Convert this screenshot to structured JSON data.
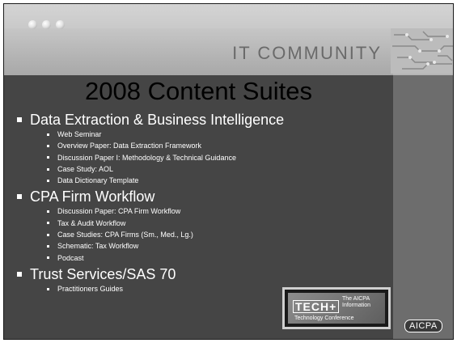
{
  "header": {
    "title": "IT COMMUNITY"
  },
  "slide": {
    "title": "2008 Content Suites"
  },
  "sections": [
    {
      "title": "Data Extraction & Business Intelligence",
      "items": [
        "Web Seminar",
        "Overview Paper: Data Extraction Framework",
        "Discussion Paper I: Methodology & Technical Guidance",
        "Case Study: AOL",
        "Data Dictionary Template"
      ]
    },
    {
      "title": "CPA Firm Workflow",
      "items": [
        "Discussion Paper: CPA Firm Workflow",
        "Tax & Audit Workflow",
        "Case Studies: CPA Firms (Sm., Med., Lg.)",
        "Schematic: Tax Workflow",
        "Podcast"
      ]
    },
    {
      "title": "Trust Services/SAS 70",
      "items": [
        "Practitioners Guides"
      ]
    }
  ],
  "logos": {
    "tech_word": "TECH+",
    "tech_tagline_1": "The AICPA",
    "tech_tagline_2": "Information",
    "tech_tagline_3": "Technology Conference",
    "aicpa": "AICPA"
  }
}
